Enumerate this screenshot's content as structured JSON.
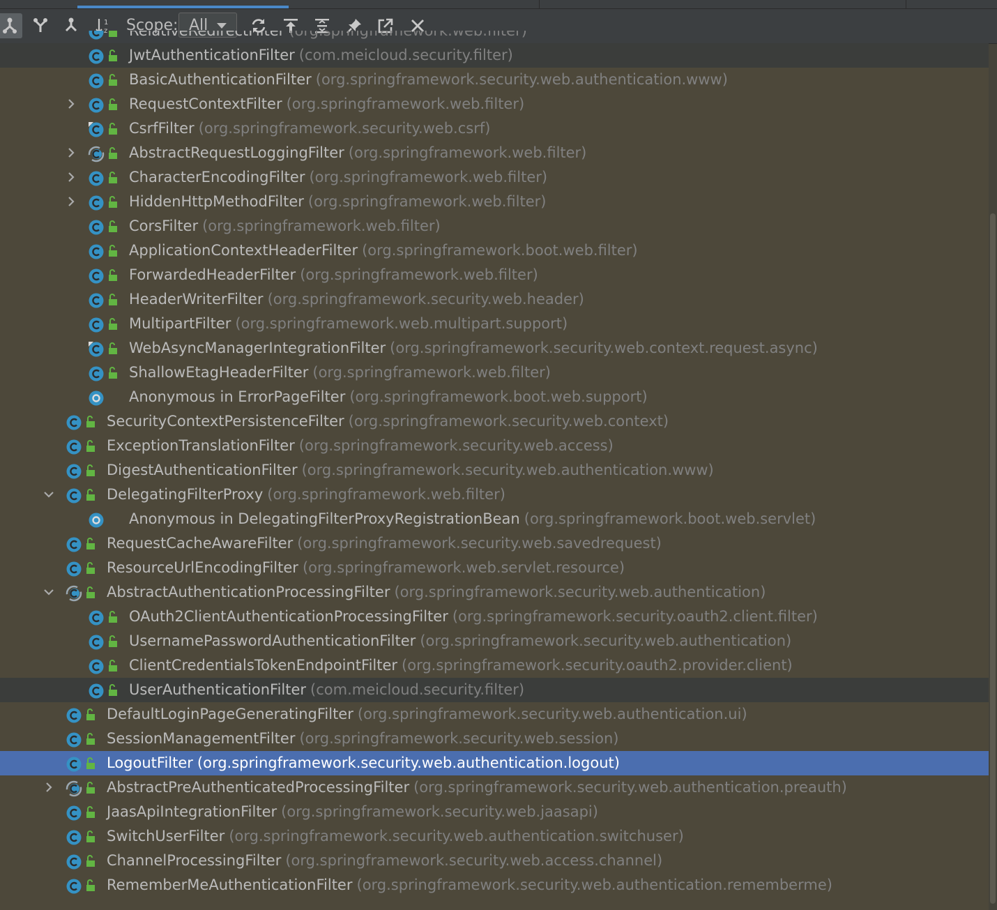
{
  "toolbar": {
    "scope_label": "Scope:",
    "scope_value": "All",
    "buttons": [
      {
        "name": "subtypes-hierarchy-button",
        "icon": "subtypes-hierarchy-icon",
        "active": true
      },
      {
        "name": "supertypes-hierarchy-button",
        "icon": "supertypes-hierarchy-icon",
        "active": false
      },
      {
        "name": "class-hierarchy-button",
        "icon": "class-hierarchy-icon",
        "active": false
      },
      {
        "name": "sort-alphabetically-button",
        "icon": "sort-alphabetically-icon",
        "active": false
      },
      {
        "name": "refresh-button",
        "icon": "refresh-icon",
        "active": false
      },
      {
        "name": "collapse-all-button",
        "icon": "collapse-all-icon",
        "active": false
      },
      {
        "name": "expand-all-button",
        "icon": "expand-all-icon",
        "active": false
      },
      {
        "name": "pin-button",
        "icon": "pin-icon",
        "active": false
      },
      {
        "name": "export-button",
        "icon": "export-icon",
        "active": false
      },
      {
        "name": "close-button",
        "icon": "close-icon",
        "active": false
      }
    ]
  },
  "colors": {
    "background": "#4d483a",
    "toolbar": "#3c3f41",
    "selection": "#4b6eaf",
    "highlight": "#3b3d3b",
    "class_icon": "#3592c4",
    "lock": "#62b543",
    "name_text": "#bbbbbb",
    "package_text": "#808080"
  },
  "tree": {
    "rows": [
      {
        "name": "RelativeRedirectFilter",
        "pkg": "(org.springframework.web.filter)",
        "level": 3,
        "expander": "none",
        "icon": "class",
        "lock": true,
        "state": "clipped"
      },
      {
        "name": "JwtAuthenticationFilter",
        "pkg": "(com.meicloud.security.filter)",
        "level": 3,
        "expander": "none",
        "icon": "class",
        "lock": true,
        "state": "highlight"
      },
      {
        "name": "BasicAuthenticationFilter",
        "pkg": "(org.springframework.security.web.authentication.www)",
        "level": 3,
        "expander": "none",
        "icon": "class",
        "lock": true,
        "state": ""
      },
      {
        "name": "RequestContextFilter",
        "pkg": "(org.springframework.web.filter)",
        "level": 3,
        "expander": "collapsed",
        "icon": "class",
        "lock": true,
        "state": ""
      },
      {
        "name": "CsrfFilter",
        "pkg": "(org.springframework.security.web.csrf)",
        "level": 3,
        "expander": "none",
        "icon": "class-final",
        "lock": true,
        "state": ""
      },
      {
        "name": "AbstractRequestLoggingFilter",
        "pkg": "(org.springframework.web.filter)",
        "level": 3,
        "expander": "collapsed",
        "icon": "abstract-class",
        "lock": true,
        "state": ""
      },
      {
        "name": "CharacterEncodingFilter",
        "pkg": "(org.springframework.web.filter)",
        "level": 3,
        "expander": "collapsed",
        "icon": "class",
        "lock": true,
        "state": ""
      },
      {
        "name": "HiddenHttpMethodFilter",
        "pkg": "(org.springframework.web.filter)",
        "level": 3,
        "expander": "collapsed",
        "icon": "class",
        "lock": true,
        "state": ""
      },
      {
        "name": "CorsFilter",
        "pkg": "(org.springframework.web.filter)",
        "level": 3,
        "expander": "none",
        "icon": "class",
        "lock": true,
        "state": ""
      },
      {
        "name": "ApplicationContextHeaderFilter",
        "pkg": "(org.springframework.boot.web.filter)",
        "level": 3,
        "expander": "none",
        "icon": "class",
        "lock": true,
        "state": ""
      },
      {
        "name": "ForwardedHeaderFilter",
        "pkg": "(org.springframework.web.filter)",
        "level": 3,
        "expander": "none",
        "icon": "class",
        "lock": true,
        "state": ""
      },
      {
        "name": "HeaderWriterFilter",
        "pkg": "(org.springframework.security.web.header)",
        "level": 3,
        "expander": "none",
        "icon": "class",
        "lock": true,
        "state": ""
      },
      {
        "name": "MultipartFilter",
        "pkg": "(org.springframework.web.multipart.support)",
        "level": 3,
        "expander": "none",
        "icon": "class",
        "lock": true,
        "state": ""
      },
      {
        "name": "WebAsyncManagerIntegrationFilter",
        "pkg": "(org.springframework.security.web.context.request.async)",
        "level": 3,
        "expander": "none",
        "icon": "class-final",
        "lock": true,
        "state": ""
      },
      {
        "name": "ShallowEtagHeaderFilter",
        "pkg": "(org.springframework.web.filter)",
        "level": 3,
        "expander": "none",
        "icon": "class",
        "lock": true,
        "state": ""
      },
      {
        "name": "Anonymous in ErrorPageFilter",
        "pkg": "(org.springframework.boot.web.support)",
        "level": 3,
        "expander": "none",
        "icon": "anonymous",
        "lock": false,
        "state": ""
      },
      {
        "name": "SecurityContextPersistenceFilter",
        "pkg": "(org.springframework.security.web.context)",
        "level": 2,
        "expander": "none",
        "icon": "class",
        "lock": true,
        "state": ""
      },
      {
        "name": "ExceptionTranslationFilter",
        "pkg": "(org.springframework.security.web.access)",
        "level": 2,
        "expander": "none",
        "icon": "class",
        "lock": true,
        "state": ""
      },
      {
        "name": "DigestAuthenticationFilter",
        "pkg": "(org.springframework.security.web.authentication.www)",
        "level": 2,
        "expander": "none",
        "icon": "class",
        "lock": true,
        "state": ""
      },
      {
        "name": "DelegatingFilterProxy",
        "pkg": "(org.springframework.web.filter)",
        "level": 2,
        "expander": "expanded",
        "icon": "class",
        "lock": true,
        "state": ""
      },
      {
        "name": "Anonymous in DelegatingFilterProxyRegistrationBean",
        "pkg": "(org.springframework.boot.web.servlet)",
        "level": 3,
        "expander": "none",
        "icon": "anonymous",
        "lock": false,
        "state": ""
      },
      {
        "name": "RequestCacheAwareFilter",
        "pkg": "(org.springframework.security.web.savedrequest)",
        "level": 2,
        "expander": "none",
        "icon": "class",
        "lock": true,
        "state": ""
      },
      {
        "name": "ResourceUrlEncodingFilter",
        "pkg": "(org.springframework.web.servlet.resource)",
        "level": 2,
        "expander": "none",
        "icon": "class",
        "lock": true,
        "state": ""
      },
      {
        "name": "AbstractAuthenticationProcessingFilter",
        "pkg": "(org.springframework.security.web.authentication)",
        "level": 2,
        "expander": "expanded",
        "icon": "abstract-class",
        "lock": true,
        "state": ""
      },
      {
        "name": "OAuth2ClientAuthenticationProcessingFilter",
        "pkg": "(org.springframework.security.oauth2.client.filter)",
        "level": 3,
        "expander": "none",
        "icon": "class",
        "lock": true,
        "state": ""
      },
      {
        "name": "UsernamePasswordAuthenticationFilter",
        "pkg": "(org.springframework.security.web.authentication)",
        "level": 3,
        "expander": "none",
        "icon": "class",
        "lock": true,
        "state": ""
      },
      {
        "name": "ClientCredentialsTokenEndpointFilter",
        "pkg": "(org.springframework.security.oauth2.provider.client)",
        "level": 3,
        "expander": "none",
        "icon": "class",
        "lock": true,
        "state": ""
      },
      {
        "name": "UserAuthenticationFilter",
        "pkg": "(com.meicloud.security.filter)",
        "level": 3,
        "expander": "none",
        "icon": "class",
        "lock": true,
        "state": "highlight"
      },
      {
        "name": "DefaultLoginPageGeneratingFilter",
        "pkg": "(org.springframework.security.web.authentication.ui)",
        "level": 2,
        "expander": "none",
        "icon": "class",
        "lock": true,
        "state": ""
      },
      {
        "name": "SessionManagementFilter",
        "pkg": "(org.springframework.security.web.session)",
        "level": 2,
        "expander": "none",
        "icon": "class",
        "lock": true,
        "state": ""
      },
      {
        "name": "LogoutFilter",
        "pkg": "(org.springframework.security.web.authentication.logout)",
        "level": 2,
        "expander": "none",
        "icon": "class",
        "lock": true,
        "state": "selected"
      },
      {
        "name": "AbstractPreAuthenticatedProcessingFilter",
        "pkg": "(org.springframework.security.web.authentication.preauth)",
        "level": 2,
        "expander": "collapsed",
        "icon": "abstract-class",
        "lock": true,
        "state": ""
      },
      {
        "name": "JaasApiIntegrationFilter",
        "pkg": "(org.springframework.security.web.jaasapi)",
        "level": 2,
        "expander": "none",
        "icon": "class",
        "lock": true,
        "state": ""
      },
      {
        "name": "SwitchUserFilter",
        "pkg": "(org.springframework.security.web.authentication.switchuser)",
        "level": 2,
        "expander": "none",
        "icon": "class",
        "lock": true,
        "state": ""
      },
      {
        "name": "ChannelProcessingFilter",
        "pkg": "(org.springframework.security.web.access.channel)",
        "level": 2,
        "expander": "none",
        "icon": "class",
        "lock": true,
        "state": ""
      },
      {
        "name": "RememberMeAuthenticationFilter",
        "pkg": "(org.springframework.security.web.authentication.rememberme)",
        "level": 2,
        "expander": "none",
        "icon": "class",
        "lock": true,
        "state": ""
      }
    ]
  }
}
